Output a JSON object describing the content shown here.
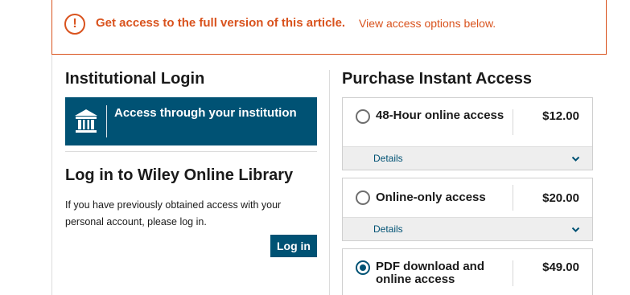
{
  "alert": {
    "icon": "info-circle-icon",
    "glyph": "!",
    "strong": "Get access to the full version of this article.",
    "normal": "View access options below.",
    "color": "#d9531e"
  },
  "institutional": {
    "heading": "Institutional Login",
    "button_label": "Access through your institution",
    "button_icon": "institution-building-icon",
    "button_color": "#005274"
  },
  "wiley_login": {
    "heading": "Log in to Wiley Online Library",
    "description": "If you have previously obtained access with your personal account, please log in.",
    "button_label": "Log in"
  },
  "purchase": {
    "heading": "Purchase Instant Access",
    "options": [
      {
        "label": "48-Hour online access",
        "price": "$12.00",
        "details": "Details",
        "selected": false
      },
      {
        "label": "Online-only access",
        "price": "$20.00",
        "details": "Details",
        "selected": false
      },
      {
        "label": "PDF download and online access",
        "price": "$49.00",
        "selected": true
      }
    ]
  }
}
